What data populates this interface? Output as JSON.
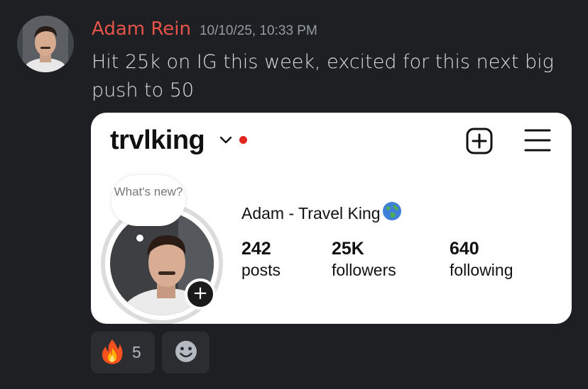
{
  "message": {
    "author": "Adam Rein",
    "timestamp": "10/10/25, 10:33 PM",
    "text": "Hit 25k on IG this week, excited for this next big push to 50",
    "author_color": "#e4544b"
  },
  "attachment": {
    "handle": "trvlking",
    "bubble_text": "What's new?",
    "display_name": "Adam - Travel King",
    "stats": [
      {
        "value": "242",
        "label": "posts"
      },
      {
        "value": "25K",
        "label": "followers"
      },
      {
        "value": "640",
        "label": "following"
      }
    ],
    "icons": [
      "chevron-down-icon",
      "notification-dot",
      "add-post-icon",
      "menu-icon",
      "globe-icon",
      "plus-icon"
    ]
  },
  "reactions": [
    {
      "emoji": "fire-emoji",
      "count": "5"
    },
    {
      "emoji": "add-reaction-icon"
    }
  ]
}
